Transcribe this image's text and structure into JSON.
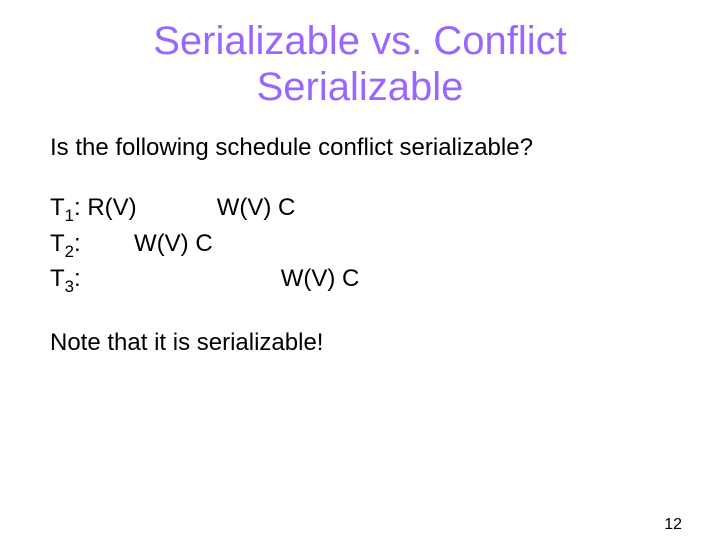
{
  "title_line1": "Serializable vs. Conflict",
  "title_line2": "Serializable",
  "question": "Is the following schedule conflict serializable?",
  "schedule": {
    "t1": {
      "label": "T",
      "sub": "1",
      "ops": ": R(V)            W(V) C"
    },
    "t2": {
      "label": "T",
      "sub": "2",
      "ops": ":        W(V) C"
    },
    "t3": {
      "label": "T",
      "sub": "3",
      "ops": ":                              W(V) C"
    }
  },
  "note": "Note that it is serializable!",
  "page_number": "12"
}
